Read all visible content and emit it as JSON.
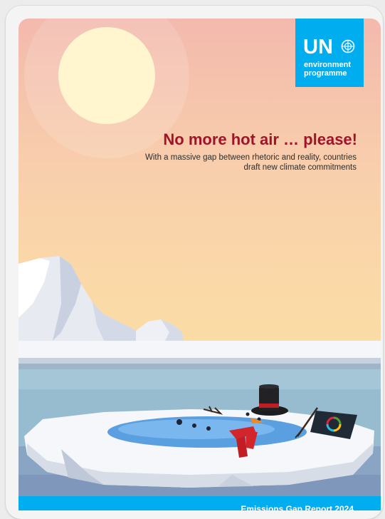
{
  "logo": {
    "un": "UN",
    "line1": "environment",
    "line2": "programme",
    "emblem_icon": "un-emblem-icon"
  },
  "cover": {
    "title": "No more hot air … please!",
    "subtitle": "With a massive gap between rhetoric and reality, countries draft new climate commitments",
    "footer_text": "Emissions Gap Report 2024"
  },
  "colors": {
    "title": "#a0142a",
    "un_blue": "#00aeef",
    "sun": "#fff6cf"
  }
}
